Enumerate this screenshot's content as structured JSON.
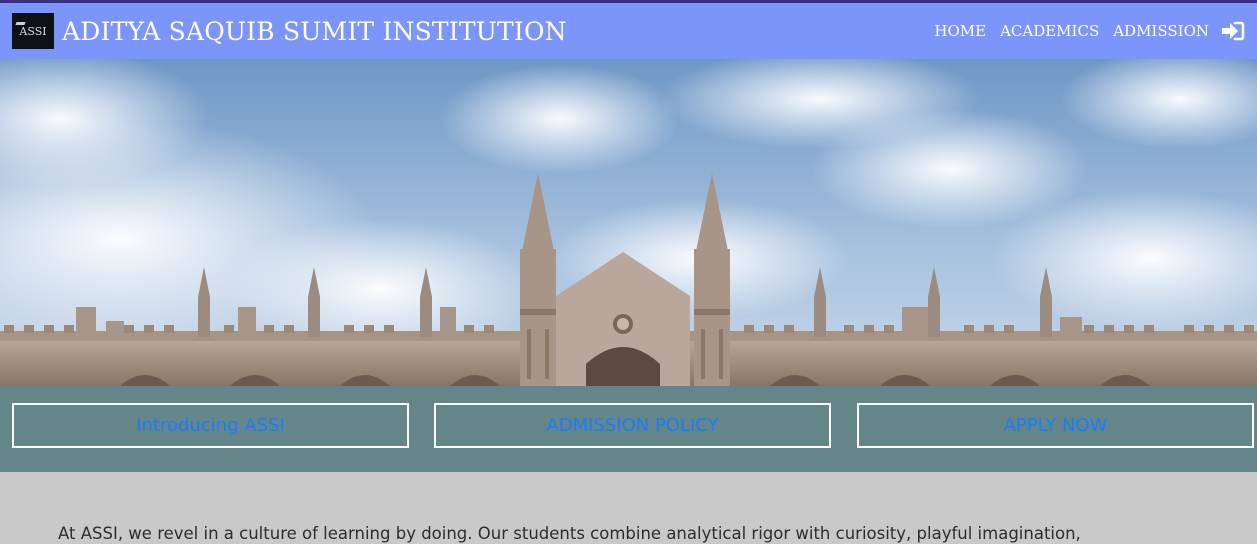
{
  "header": {
    "logo_text": "ASSI",
    "title": "ADITYA SAQUIB SUMIT INSTITUTION",
    "nav": [
      "HOME",
      "ACADEMICS",
      "ADMISSION"
    ],
    "login_icon": "sign-in-icon"
  },
  "hero": {
    "image": "gothic-college-building-under-cloudy-sky"
  },
  "actions": {
    "intro_label": "Introducing ASSI",
    "policy_label": "ADMISSION POLICY",
    "apply_label": "APPLY NOW"
  },
  "content": {
    "intro_text": "At ASSI, we revel in a culture of learning by doing. Our students combine analytical rigor with curiosity, playful imagination,"
  },
  "colors": {
    "navbar": "#7b95fb",
    "action_bar": "#648689",
    "button_text": "#1a7dff",
    "page_background": "#c9c9c9"
  }
}
